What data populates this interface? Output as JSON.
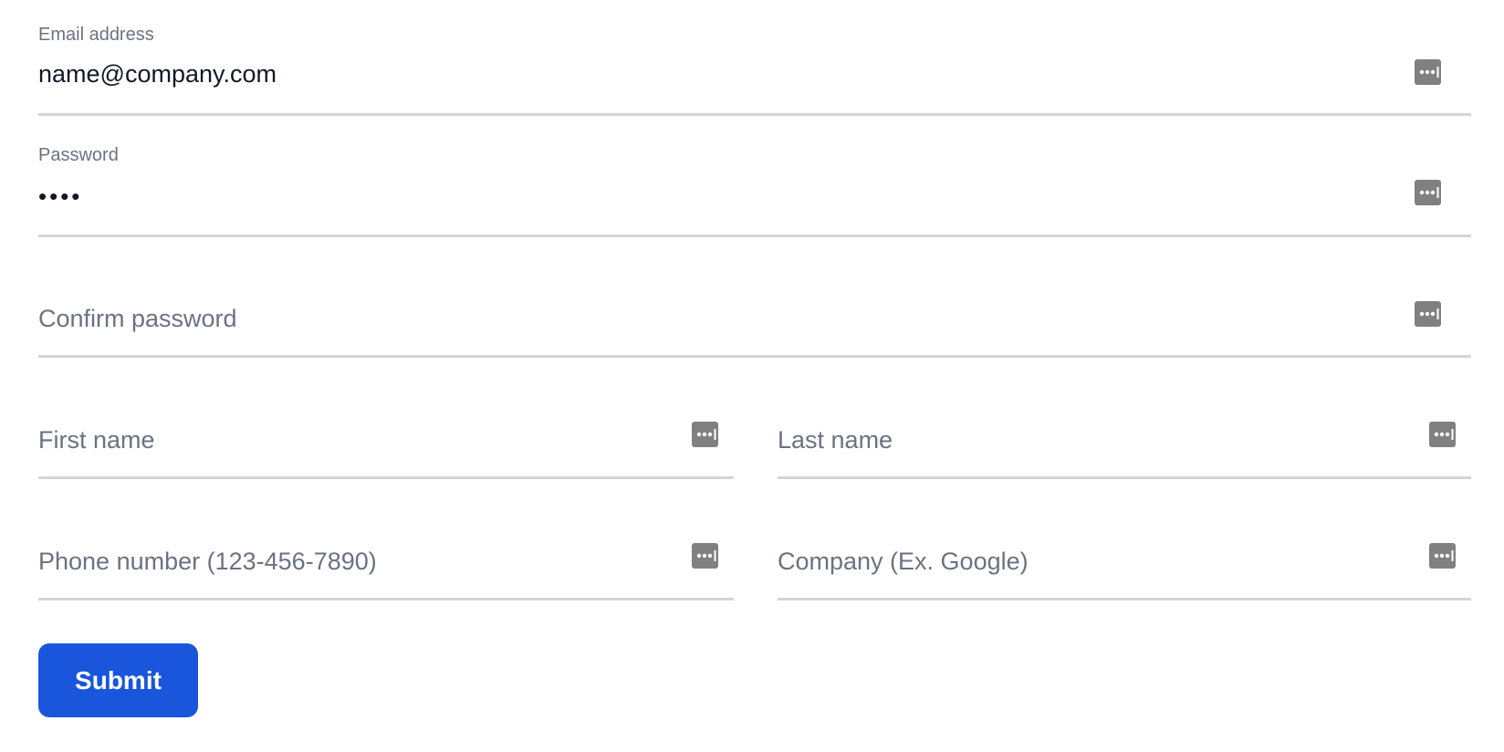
{
  "form": {
    "email": {
      "label": "Email address",
      "value": "name@company.com"
    },
    "password": {
      "label": "Password",
      "value": "••••"
    },
    "confirm_password": {
      "placeholder": "Confirm password"
    },
    "first_name": {
      "placeholder": "First name"
    },
    "last_name": {
      "placeholder": "Last name"
    },
    "phone": {
      "placeholder": "Phone number (123-456-7890)"
    },
    "company": {
      "placeholder": "Company (Ex. Google)"
    },
    "submit_label": "Submit"
  },
  "icons": {
    "field_icon": "password-manager-icon"
  },
  "colors": {
    "primary": "#1a56db",
    "label": "#6b7280",
    "text": "#111827",
    "underline": "#d1d5db",
    "icon": "#808080"
  }
}
